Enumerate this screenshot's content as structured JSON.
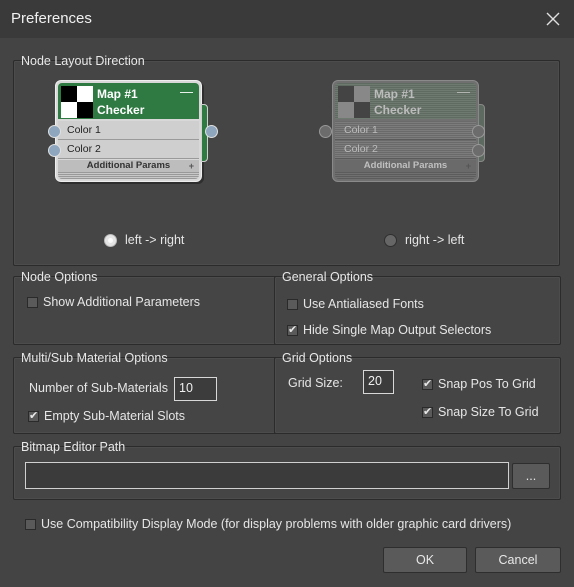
{
  "window": {
    "title": "Preferences"
  },
  "node_layout": {
    "title": "Node Layout Direction",
    "node": {
      "name": "Map #1",
      "type": "Checker",
      "minus": "—",
      "params": [
        "Color 1",
        "Color 2"
      ],
      "additional": "Additional Params",
      "plus": "+"
    },
    "options": [
      {
        "label": "left -> right",
        "selected": true
      },
      {
        "label": "right -> left",
        "selected": false
      }
    ]
  },
  "node_options": {
    "title": "Node Options",
    "show_additional": {
      "label": "Show Additional Parameters",
      "checked": false
    }
  },
  "general_options": {
    "title": "General Options",
    "antialiased": {
      "label": "Use Antialiased Fonts",
      "checked": false
    },
    "hide_selectors": {
      "label": "Hide Single Map Output Selectors",
      "checked": true
    }
  },
  "multi_sub": {
    "title": "Multi/Sub Material Options",
    "num_label": "Number of Sub-Materials",
    "num_value": "10",
    "empty_slots": {
      "label": "Empty Sub-Material Slots",
      "checked": true
    }
  },
  "grid_options": {
    "title": "Grid Options",
    "size_label": "Grid Size:",
    "size_value": "20",
    "snap_pos": {
      "label": "Snap Pos To Grid",
      "checked": true
    },
    "snap_size": {
      "label": "Snap Size To Grid",
      "checked": true
    }
  },
  "bitmap_editor": {
    "title": "Bitmap Editor Path",
    "value": "",
    "browse_label": "..."
  },
  "compat_mode": {
    "label": "Use Compatibility Display Mode (for display problems with older graphic card drivers)",
    "checked": false
  },
  "buttons": {
    "ok": "OK",
    "cancel": "Cancel"
  },
  "colors": {
    "node_header": "#2f7a42",
    "background": "#444444"
  }
}
